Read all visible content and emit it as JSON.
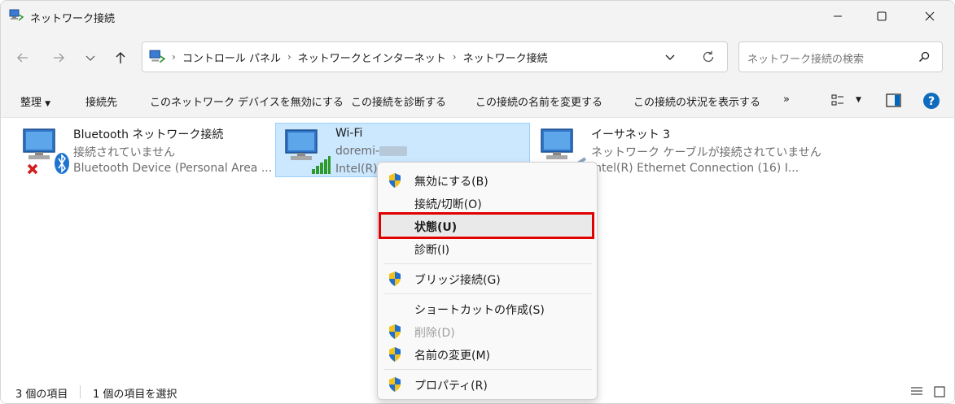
{
  "window": {
    "title": "ネットワーク接続"
  },
  "address": {
    "crumbs": [
      "コントロール パネル",
      "ネットワークとインターネット",
      "ネットワーク接続"
    ]
  },
  "search": {
    "placeholder": "ネットワーク接続の検索"
  },
  "commands": {
    "organize": "整理",
    "connect_to": "接続先",
    "disable_device": "このネットワーク デバイスを無効にする",
    "diagnose": "この接続を診断する",
    "rename": "この接続の名前を変更する",
    "view_status": "この接続の状況を表示する",
    "more": "»"
  },
  "connections": [
    {
      "name": "Bluetooth ネットワーク接続",
      "status": "接続されていません",
      "device": "Bluetooth Device (Personal Area ..."
    },
    {
      "name": "Wi-Fi",
      "status": "doremi-",
      "device": "Intel(R)"
    },
    {
      "name": "イーサネット 3",
      "status": "ネットワーク ケーブルが接続されていません",
      "device": "Intel(R) Ethernet Connection (16) I..."
    }
  ],
  "context_menu": {
    "items": [
      {
        "label": "無効にする(B)",
        "shield": true
      },
      {
        "label": "接続/切断(O)",
        "shield": false
      },
      {
        "label": "状態(U)",
        "shield": false,
        "bold": true,
        "highlighted": true
      },
      {
        "label": "診断(I)",
        "shield": false
      },
      {
        "label": "ブリッジ接続(G)",
        "shield": true
      },
      {
        "label": "ショートカットの作成(S)",
        "shield": false
      },
      {
        "label": "削除(D)",
        "shield": true,
        "disabled": true
      },
      {
        "label": "名前の変更(M)",
        "shield": true
      },
      {
        "label": "プロパティ(R)",
        "shield": true
      }
    ]
  },
  "statusbar": {
    "item_count": "3 個の項目",
    "selected_count": "1 個の項目を選択"
  },
  "colors": {
    "accent": "#0067c0",
    "selection": "#cce8ff",
    "highlight_box": "#e00000"
  }
}
